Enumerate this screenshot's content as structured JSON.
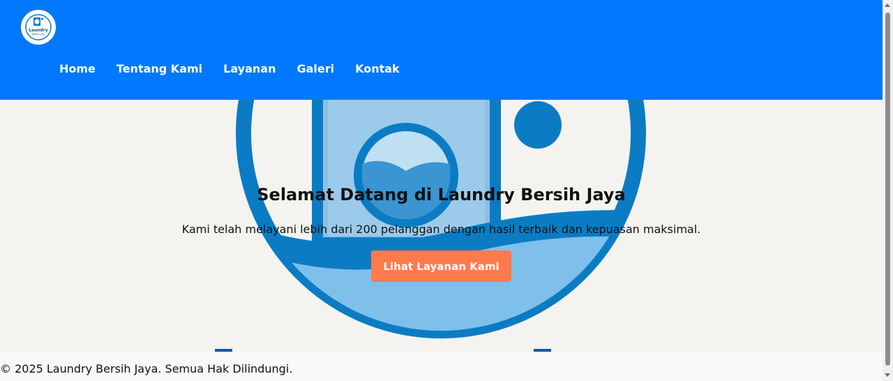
{
  "header": {
    "logo": {
      "text_top": "Laundry",
      "text_bottom": "BERSIH JAYA",
      "icon": "washing-machine-icon"
    },
    "nav": [
      "Home",
      "Tentang Kami",
      "Layanan",
      "Galeri",
      "Kontak"
    ]
  },
  "hero": {
    "title": "Selamat Datang di Laundry Bersih Jaya",
    "text": "Kami telah melayani lebih dari 200 pelanggan dengan hasil terbaik dan kepuasan maksimal.",
    "button_label": "Lihat Layanan Kami",
    "background_icon": "washing-machine-icon"
  },
  "footer": {
    "copyright": "© 2025 Laundry Bersih Jaya. Semua Hak Dilindungi."
  },
  "colors": {
    "header_bg": "#0278fe",
    "button_bg": "#ff7a4d",
    "art_blue": "#0b7cc4"
  }
}
